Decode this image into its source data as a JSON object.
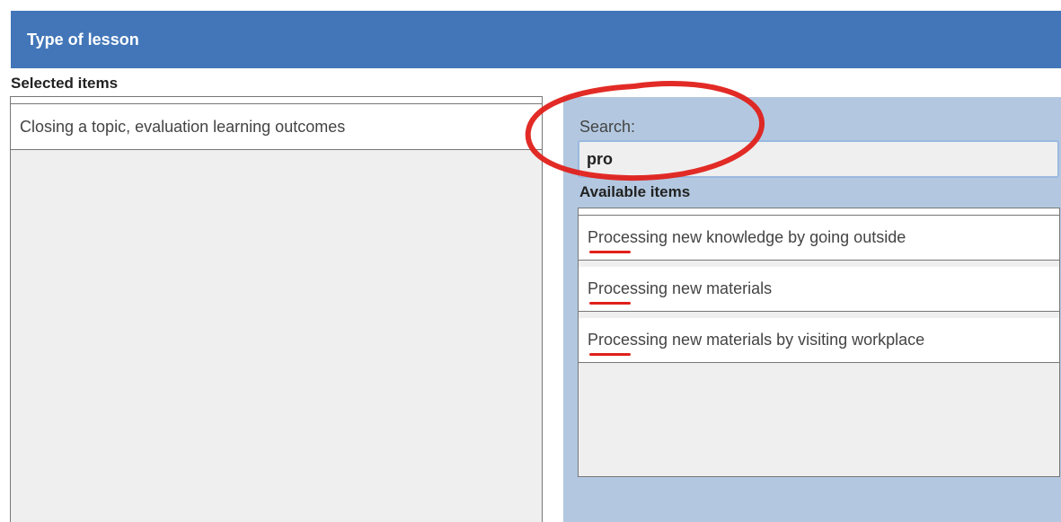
{
  "header": {
    "title": "Type of lesson"
  },
  "selected": {
    "label": "Selected items",
    "items": [
      "Closing a topic, evaluation learning outcomes"
    ]
  },
  "search": {
    "label": "Search:",
    "value": "pro"
  },
  "available": {
    "label": "Available items",
    "items": [
      "Processing new knowledge by going outside",
      "Processing new materials",
      "Processing new materials by visiting workplace"
    ]
  },
  "colors": {
    "header": "#4276b8",
    "right_panel": "#b3c8e0",
    "highlight": "#e0201a"
  }
}
